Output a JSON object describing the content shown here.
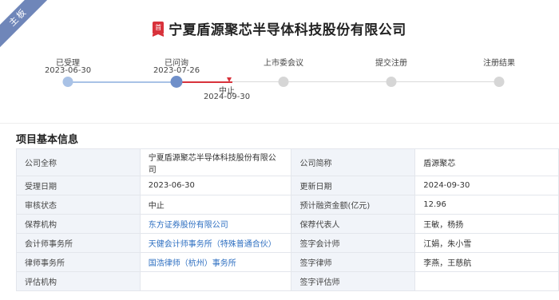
{
  "ribbon": {
    "text": "主板"
  },
  "header": {
    "badge": "首",
    "title": "宁夏盾源聚芯半导体科技股份有限公司"
  },
  "timeline": {
    "steps": [
      {
        "label": "已受理",
        "date": "2023-06-30",
        "state": "done"
      },
      {
        "label": "已问询",
        "date": "2023-07-26",
        "state": "current"
      },
      {
        "label": "上市委会议",
        "date": "",
        "state": "pending"
      },
      {
        "label": "提交注册",
        "date": "",
        "state": "pending"
      },
      {
        "label": "注册结果",
        "date": "",
        "state": "pending"
      }
    ],
    "stop": {
      "label": "中止",
      "date": "2024-09-30"
    }
  },
  "section": {
    "title": "项目基本信息"
  },
  "table": {
    "rows": [
      {
        "l1": "公司全称",
        "v1": "宁夏盾源聚芯半导体科技股份有限公司",
        "l2": "公司简称",
        "v2": "盾源聚芯"
      },
      {
        "l1": "受理日期",
        "v1": "2023-06-30",
        "l2": "更新日期",
        "v2": "2024-09-30"
      },
      {
        "l1": "审核状态",
        "v1": "中止",
        "l2": "预计融资金额(亿元)",
        "v2": "12.96"
      },
      {
        "l1": "保荐机构",
        "v1": "东方证券股份有限公司",
        "l2": "保荐代表人",
        "v2": "王敏，杨扬"
      },
      {
        "l1": "会计师事务所",
        "v1": "天健会计师事务所（特殊普通合伙）",
        "l2": "签字会计师",
        "v2": "江娟，朱小雪"
      },
      {
        "l1": "律师事务所",
        "v1": "国浩律师（杭州）事务所",
        "l2": "签字律师",
        "v2": "李燕，王慈航"
      },
      {
        "l1": "评估机构",
        "v1": "",
        "l2": "签字评估师",
        "v2": ""
      }
    ]
  },
  "colors": {
    "accent_blue": "#6f8fc9",
    "link_blue": "#2e6fc1",
    "stop_red": "#d8323b",
    "ribbon": "#6f86b9"
  }
}
